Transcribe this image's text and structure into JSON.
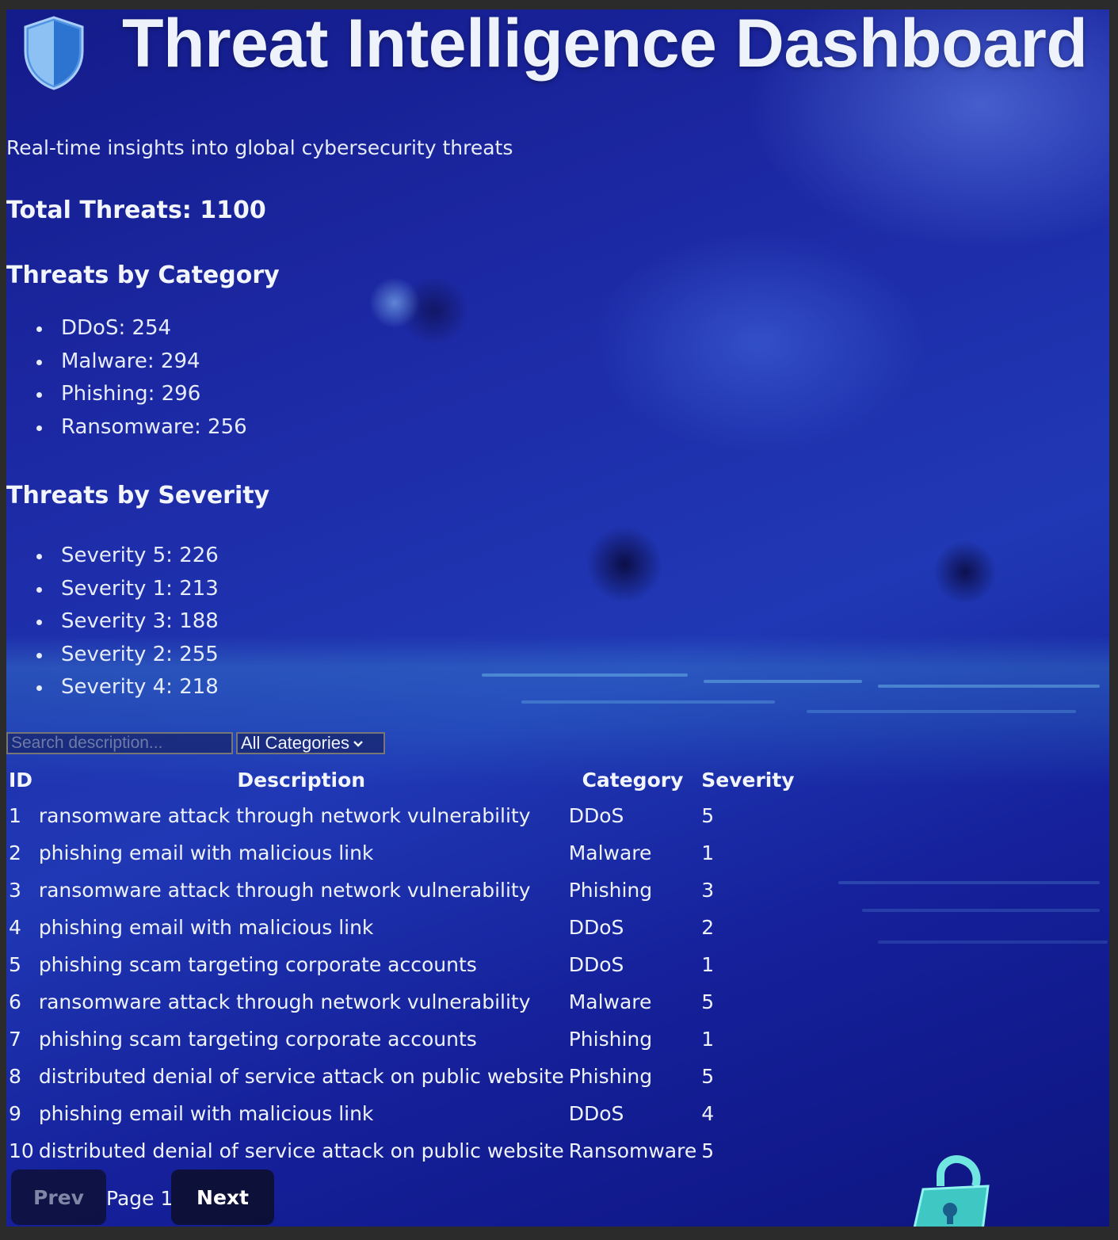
{
  "header": {
    "title": "Threat Intelligence Dashboard",
    "subtitle": "Real-time insights into global cybersecurity threats",
    "icon": "shield-icon"
  },
  "summary": {
    "total_label": "Total Threats: 1100"
  },
  "category_section": {
    "heading": "Threats by Category",
    "items": [
      {
        "label": "DDoS: 254"
      },
      {
        "label": "Malware: 294"
      },
      {
        "label": "Phishing: 296"
      },
      {
        "label": "Ransomware: 256"
      }
    ]
  },
  "severity_section": {
    "heading": "Threats by Severity",
    "items": [
      {
        "label": "Severity 5: 226"
      },
      {
        "label": "Severity 1: 213"
      },
      {
        "label": "Severity 3: 188"
      },
      {
        "label": "Severity 2: 255"
      },
      {
        "label": "Severity 4: 218"
      }
    ]
  },
  "filters": {
    "search_placeholder": "Search description...",
    "search_value": "",
    "category_selected": "All Categories"
  },
  "table": {
    "columns": [
      "ID",
      "Description",
      "Category",
      "Severity"
    ],
    "rows": [
      {
        "id": "1",
        "description": "ransomware attack through network vulnerability",
        "category": "DDoS",
        "severity": "5"
      },
      {
        "id": "2",
        "description": "phishing email with malicious link",
        "category": "Malware",
        "severity": "1"
      },
      {
        "id": "3",
        "description": "ransomware attack through network vulnerability",
        "category": "Phishing",
        "severity": "3"
      },
      {
        "id": "4",
        "description": "phishing email with malicious link",
        "category": "DDoS",
        "severity": "2"
      },
      {
        "id": "5",
        "description": "phishing scam targeting corporate accounts",
        "category": "DDoS",
        "severity": "1"
      },
      {
        "id": "6",
        "description": "ransomware attack through network vulnerability",
        "category": "Malware",
        "severity": "5"
      },
      {
        "id": "7",
        "description": "phishing scam targeting corporate accounts",
        "category": "Phishing",
        "severity": "1"
      },
      {
        "id": "8",
        "description": "distributed denial of service attack on public website",
        "category": "Phishing",
        "severity": "5"
      },
      {
        "id": "9",
        "description": "phishing email with malicious link",
        "category": "DDoS",
        "severity": "4"
      },
      {
        "id": "10",
        "description": "distributed denial of service attack on public website",
        "category": "Ransomware",
        "severity": "5"
      }
    ]
  },
  "pagination": {
    "prev_label": "Prev",
    "page_label": "Page 1",
    "next_label": "Next"
  },
  "colors": {
    "background_primary": "#1d2aa6",
    "shield_light": "#7fb6f2",
    "shield_dark": "#2f7fd8",
    "lock_accent": "#45d6d0"
  }
}
